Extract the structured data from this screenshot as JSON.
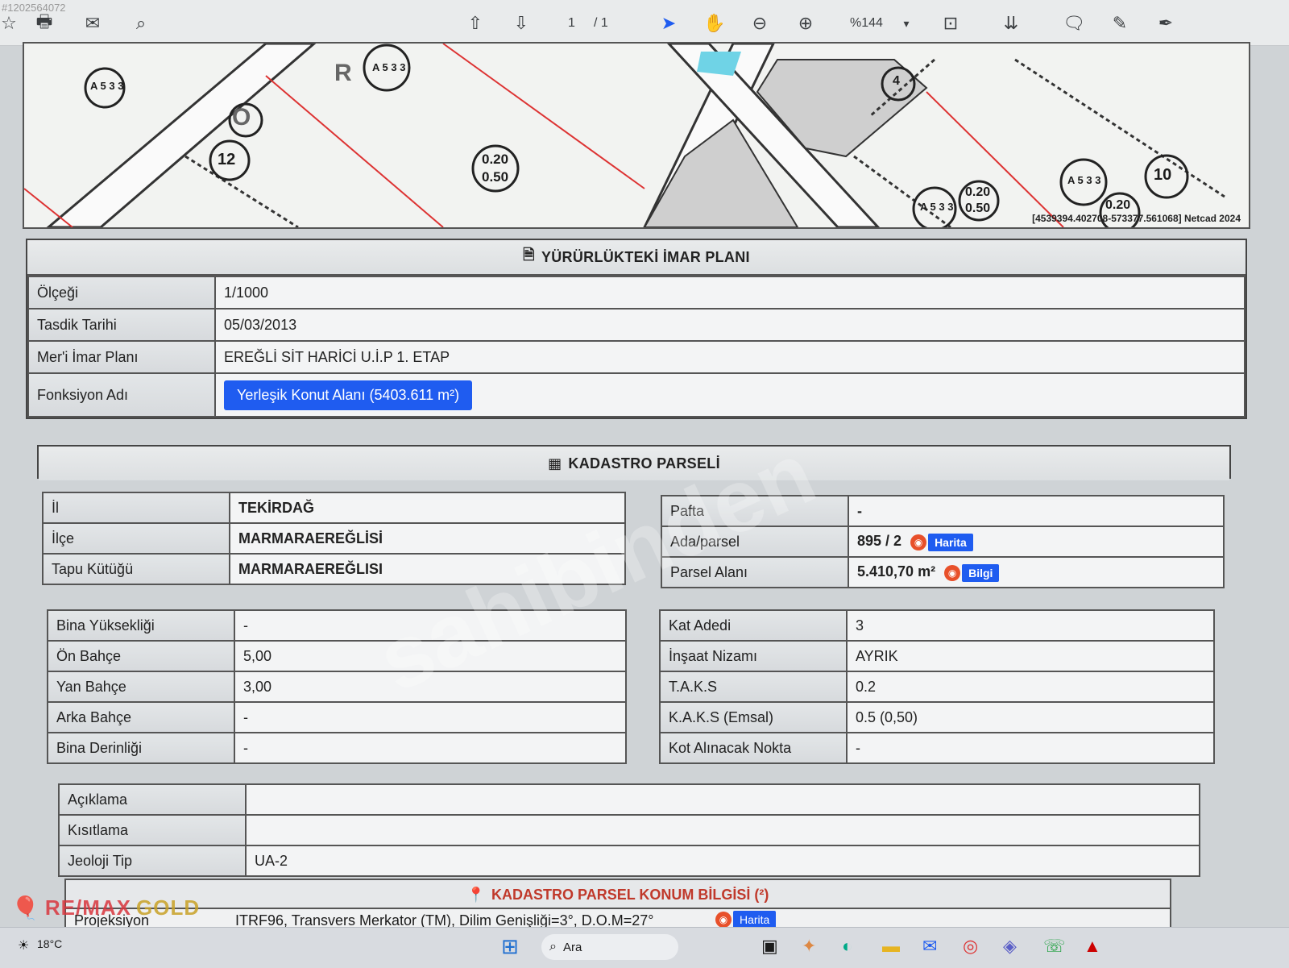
{
  "toolbar": {
    "page_current": "1",
    "page_total": "/ 1",
    "zoom": "%144",
    "corner_id": "#1202564072"
  },
  "map": {
    "labels": [
      "A 5 3 3",
      "R",
      "A 5 3 3",
      "12",
      "0.20",
      "0.50",
      "0.20",
      "0.50",
      "A 5 3 3",
      "A 5 3 3",
      "10",
      "0.20",
      "4",
      "O"
    ],
    "coord": "[4539394.402708-573377.561068] Netcad 2024"
  },
  "imar": {
    "title": "YÜRÜRLÜKTEKİ İMAR PLANI",
    "rows": [
      {
        "label": "Ölçeği",
        "value": "1/1000"
      },
      {
        "label": "Tasdik Tarihi",
        "value": "05/03/2013"
      },
      {
        "label": "Mer'i İmar Planı",
        "value": "EREĞLİ SİT HARİCİ U.İ.P 1. ETAP"
      }
    ],
    "function_label": "Fonksiyon Adı",
    "function_value": "Yerleşik Konut Alanı (5403.611 m²)"
  },
  "kadastro": {
    "title": "KADASTRO PARSELİ",
    "left_rows": [
      {
        "label": "İl",
        "value": "TEKİRDAĞ"
      },
      {
        "label": "İlçe",
        "value": "MARMARAEREĞLİSİ"
      },
      {
        "label": "Tapu Kütüğü",
        "value": "MARMARAEREĞLISI"
      }
    ],
    "right_rows": [
      {
        "label": "Pafta",
        "value": "-"
      },
      {
        "label": "Ada/parsel",
        "value": "895 / 2",
        "button": "Harita"
      },
      {
        "label": "Parsel Alanı",
        "value": "5.410,70 m²",
        "button": "Bilgi"
      }
    ]
  },
  "building_left": [
    {
      "label": "Bina Yüksekliği",
      "value": "-"
    },
    {
      "label": "Ön Bahçe",
      "value": "5,00"
    },
    {
      "label": "Yan Bahçe",
      "value": "3,00"
    },
    {
      "label": "Arka Bahçe",
      "value": "-"
    },
    {
      "label": "Bina Derinliği",
      "value": "-"
    }
  ],
  "building_right": [
    {
      "label": "Kat Adedi",
      "value": "3"
    },
    {
      "label": "İnşaat Nizamı",
      "value": "AYRIK"
    },
    {
      "label": "T.A.K.S",
      "value": "0.2"
    },
    {
      "label": "K.A.K.S (Emsal)",
      "value": "0.5 (0,50)"
    },
    {
      "label": "Kot Alınacak Nokta",
      "value": "-"
    }
  ],
  "notes": [
    {
      "label": "Açıklama",
      "value": ""
    },
    {
      "label": "Kısıtlama",
      "value": ""
    },
    {
      "label": "Jeoloji Tip",
      "value": "UA-2"
    }
  ],
  "konum": {
    "title": "KADASTRO PARSEL KONUM BİLGİSİ (²)",
    "proj_label": "Projeksiyon",
    "proj_value": "ITRF96, Transvers Merkator (TM), Dilim Genişliği=3°, D.O.M=27°",
    "proj_button": "Harita"
  },
  "taskbar": {
    "weather": "18°C",
    "search_label": "Ara"
  },
  "branding": {
    "logo_main": "RE/MAX",
    "logo_sub": "GOLD",
    "watermark": "sahibinden"
  },
  "colors": {
    "accent_blue": "#1f5cf0",
    "konum_red": "#c0392b"
  }
}
